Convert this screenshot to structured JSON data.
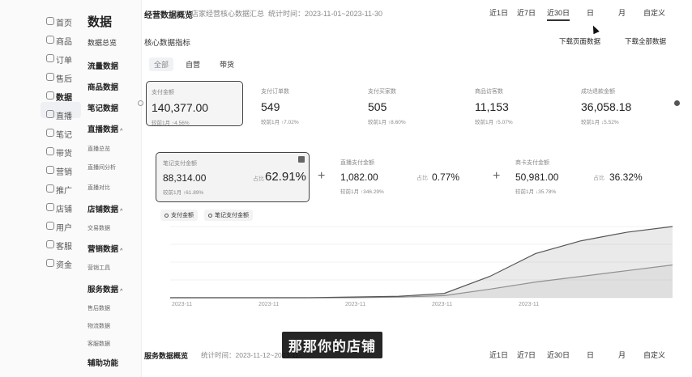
{
  "nav_primary": [
    {
      "label": "首页",
      "icon": "home-icon"
    },
    {
      "label": "商品",
      "icon": "product-icon"
    },
    {
      "label": "订单",
      "icon": "order-icon"
    },
    {
      "label": "售后",
      "icon": "aftersale-icon"
    },
    {
      "label": "数据",
      "icon": "data-icon",
      "active": true
    },
    {
      "label": "直播",
      "icon": "live-icon"
    },
    {
      "label": "笔记",
      "icon": "note-icon"
    },
    {
      "label": "带货",
      "icon": "sell-icon"
    },
    {
      "label": "营销",
      "icon": "marketing-icon"
    },
    {
      "label": "推广",
      "icon": "promote-icon"
    },
    {
      "label": "店铺",
      "icon": "store-icon"
    },
    {
      "label": "用户",
      "icon": "user-icon"
    },
    {
      "label": "客服",
      "icon": "service-icon"
    },
    {
      "label": "资金",
      "icon": "funds-icon"
    }
  ],
  "nav_secondary": {
    "title": "数据",
    "items": [
      {
        "label": "数据总览",
        "style": "normal"
      },
      {
        "label": "流量数据",
        "style": "bold"
      },
      {
        "label": "商品数据",
        "style": "bold"
      },
      {
        "label": "笔记数据",
        "style": "bold"
      },
      {
        "label": "直播数据",
        "style": "bold",
        "caret": "^"
      },
      {
        "label": "直播总览",
        "style": "sub"
      },
      {
        "label": "直播间分析",
        "style": "sub"
      },
      {
        "label": "直播对比",
        "style": "sub"
      },
      {
        "label": "店铺数据",
        "style": "bold",
        "caret": "^"
      },
      {
        "label": "交易数据",
        "style": "sub"
      },
      {
        "label": "营销数据",
        "style": "bold",
        "caret": "^"
      },
      {
        "label": "营销工具",
        "style": "sub"
      },
      {
        "label": "服务数据",
        "style": "bold",
        "caret": "^"
      },
      {
        "label": "售后数据",
        "style": "sub"
      },
      {
        "label": "物流数据",
        "style": "sub"
      },
      {
        "label": "客服数据",
        "style": "sub"
      },
      {
        "label": "辅助功能",
        "style": "bold"
      }
    ]
  },
  "header": {
    "title": "经营数据概览",
    "subtitle": "店家经营核心数据汇总",
    "period": "统计时间：2023-11-01~2023-11-30",
    "ranges": [
      "近1日",
      "近7日",
      "近30日",
      "日",
      "月",
      "自定义"
    ],
    "active_range": "近30日"
  },
  "core": {
    "title": "核心数据指标",
    "download_page": "下载页面数据",
    "download_all": "下载全部数据",
    "tabs": [
      "全部",
      "自营",
      "带货"
    ],
    "active_tab": "全部",
    "metrics": [
      {
        "label": "支付金额",
        "value": "140,377.00",
        "compare": "较前1月 ↑4.56%",
        "selected": true
      },
      {
        "label": "支付订单数",
        "value": "549",
        "compare": "较前1月 ↑7.02%"
      },
      {
        "label": "支付买家数",
        "value": "505",
        "compare": "较前1月 ↑8.60%"
      },
      {
        "label": "商品访客数",
        "value": "11,153",
        "compare": "较前1月 ↑5.07%"
      },
      {
        "label": "成功退款金额",
        "value": "36,058.18",
        "compare": "较前1月 ↓5.52%"
      }
    ]
  },
  "breakdown": {
    "items": [
      {
        "label": "笔记支付金额",
        "value": "88,314.00",
        "compare": "较前1月 ↑61.89%",
        "share_label": "占比",
        "share": "62.91%"
      },
      {
        "label": "直播支付金额",
        "value": "1,082.00",
        "compare": "较前1月 ↑346.29%",
        "share_label": "占比",
        "share": "0.77%"
      },
      {
        "label": "商卡支付金额",
        "value": "50,981.00",
        "compare": "较前1月 ↓35.78%",
        "share_label": "占比",
        "share": "36.32%"
      }
    ],
    "legend": [
      "支付金额",
      "笔记支付金额"
    ]
  },
  "chart_data": {
    "type": "area",
    "x": [
      "2023-11-01",
      "2023-11-07",
      "2023-11-13",
      "2023-11-19",
      "2023-11-25",
      "2023-11-30"
    ],
    "x_tick_labels": [
      "2023-11",
      "2023-11",
      "2023-11",
      "2023-11",
      "2023-11",
      ""
    ],
    "series": [
      {
        "name": "支付金额",
        "values": [
          0,
          0,
          0,
          0,
          1,
          2,
          6,
          30,
          62,
          80,
          92,
          100
        ],
        "color": "#555555"
      },
      {
        "name": "笔记支付金额",
        "values": [
          0,
          0,
          0,
          0,
          0,
          1,
          3,
          12,
          22,
          30,
          38,
          46
        ],
        "color": "#999999"
      }
    ]
  },
  "service": {
    "title": "服务数据概览",
    "period": "统计时间：2023-11-12~2023-11-",
    "ranges": [
      "近1日",
      "近7日",
      "近30日",
      "日",
      "月",
      "自定义"
    ]
  },
  "caption": "那那你的店铺",
  "colors": {
    "accent": "#222222",
    "muted": "#888888",
    "selected_bg": "#f5f5f5"
  }
}
